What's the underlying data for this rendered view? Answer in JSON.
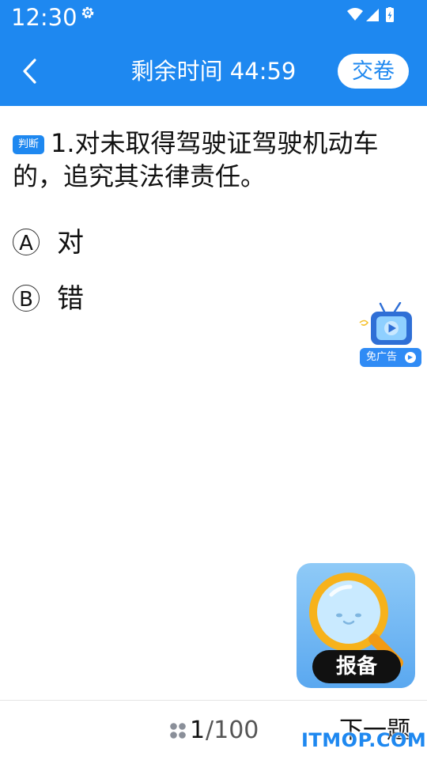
{
  "status_bar": {
    "time": "12:30",
    "icons": [
      "settings-icon",
      "wifi-icon",
      "signal-icon",
      "battery-charging-icon"
    ]
  },
  "app_bar": {
    "back_icon": "chevron-left-icon",
    "timer_text": "剩余时间 44:59",
    "submit_label": "交卷"
  },
  "question": {
    "type_badge": "判断",
    "text": "1.对未取得驾驶证驾驶机动车的，追究其法律责任。",
    "options": [
      {
        "letter": "A",
        "text": "对"
      },
      {
        "letter": "B",
        "text": "错"
      }
    ]
  },
  "floating": {
    "ad_free_label": "免广告",
    "signup_label": "报备"
  },
  "bottom_bar": {
    "progress_icon": "grid-icon",
    "current": "1",
    "total": "/100",
    "next_label": "下一题"
  },
  "watermark": "ITMOP.COM",
  "colors": {
    "primary": "#1e88f0",
    "background": "#ffffff",
    "text": "#111111"
  }
}
